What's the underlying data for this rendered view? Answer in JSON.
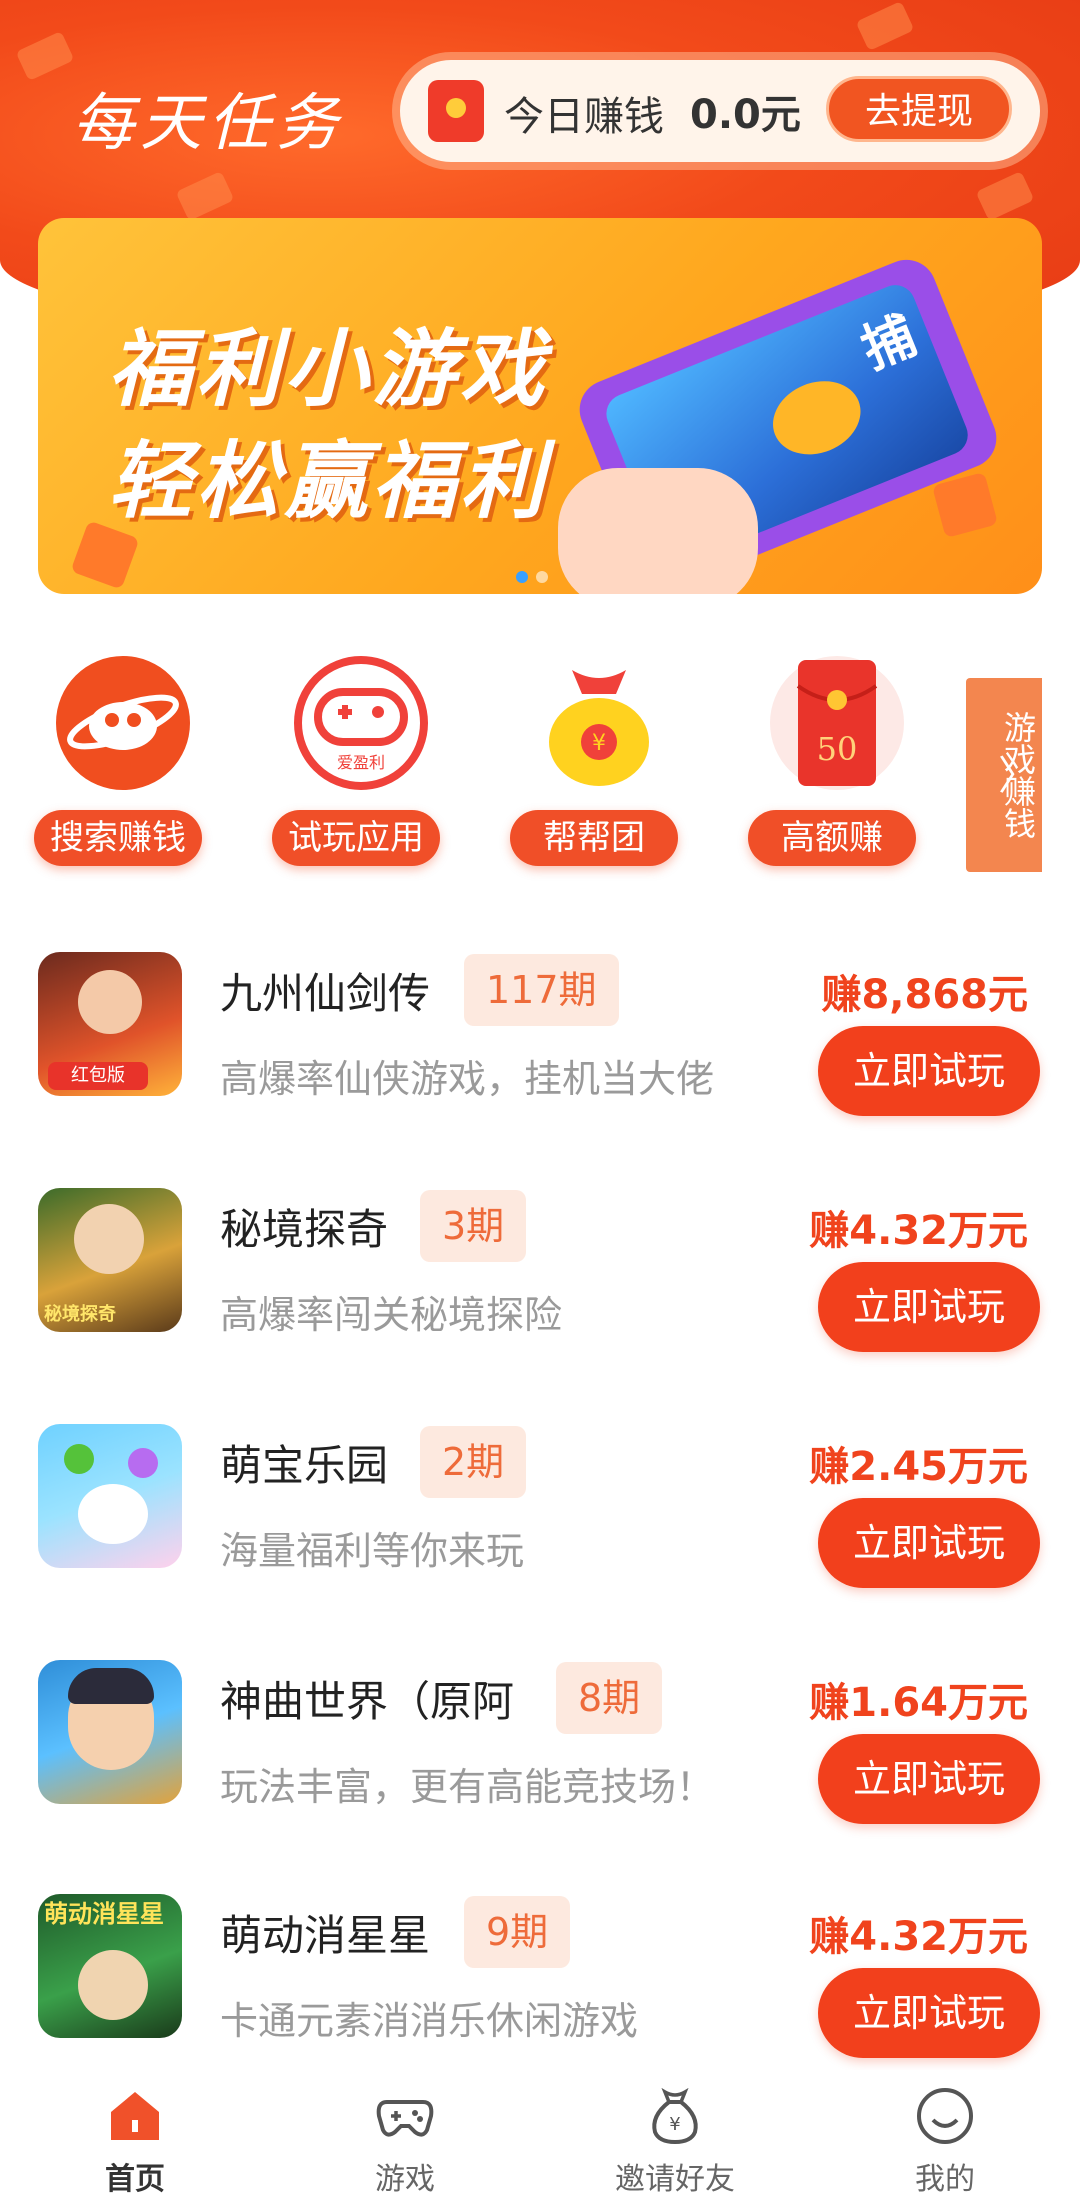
{
  "header": {
    "title": "每天任务",
    "earn_label": "今日赚钱",
    "earn_amount": "0.0元",
    "withdraw_label": "去提现"
  },
  "banner": {
    "line1": "福利小游戏",
    "line2": "轻松赢福利",
    "phone_text": "捕",
    "slide_count": 2,
    "active_slide": 1
  },
  "quick_entries": [
    {
      "label": "搜索赚钱",
      "icon": "planet-icon",
      "color": "#f04e1f"
    },
    {
      "label": "试玩应用",
      "icon": "gamepad-icon",
      "sub": "爱盈利",
      "color": "#f0413a"
    },
    {
      "label": "帮帮团",
      "icon": "money-bag-icon",
      "color": "#ffd21f"
    },
    {
      "label": "高额赚",
      "icon": "red-envelope-icon",
      "value": "50",
      "color": "#e9342b"
    }
  ],
  "side_tab": {
    "label": "游戏赚钱"
  },
  "games": [
    {
      "name": "九州仙剑传",
      "period": "117期",
      "desc": "高爆率仙侠游戏，挂机当大佬",
      "reward": "赚8,868元",
      "cta": "立即试玩",
      "badge": "红包版"
    },
    {
      "name": "秘境探奇",
      "period": "3期",
      "desc": "高爆率闯关秘境探险",
      "reward": "赚4.32万元",
      "cta": "立即试玩",
      "badge": "秘境探奇"
    },
    {
      "name": "萌宝乐园",
      "period": "2期",
      "desc": "海量福利等你来玩",
      "reward": "赚2.45万元",
      "cta": "立即试玩"
    },
    {
      "name": "神曲世界（原阿",
      "period": "8期",
      "desc": "玩法丰富，更有高能竞技场！",
      "reward": "赚1.64万元",
      "cta": "立即试玩"
    },
    {
      "name": "萌动消星星",
      "period": "9期",
      "desc": "卡通元素消消乐休闲游戏",
      "reward": "赚4.32万元",
      "cta": "立即试玩",
      "badge": "萌动消星星"
    }
  ],
  "bottom_nav": [
    {
      "label": "首页",
      "icon": "home-icon",
      "active": true
    },
    {
      "label": "游戏",
      "icon": "gamepad-icon",
      "active": false
    },
    {
      "label": "邀请好友",
      "icon": "money-bag-icon",
      "active": false
    },
    {
      "label": "我的",
      "icon": "smile-icon",
      "active": false
    }
  ],
  "colors": {
    "accent": "#f2401c",
    "header": "#f24a1a",
    "banner": "#ffa71e"
  }
}
